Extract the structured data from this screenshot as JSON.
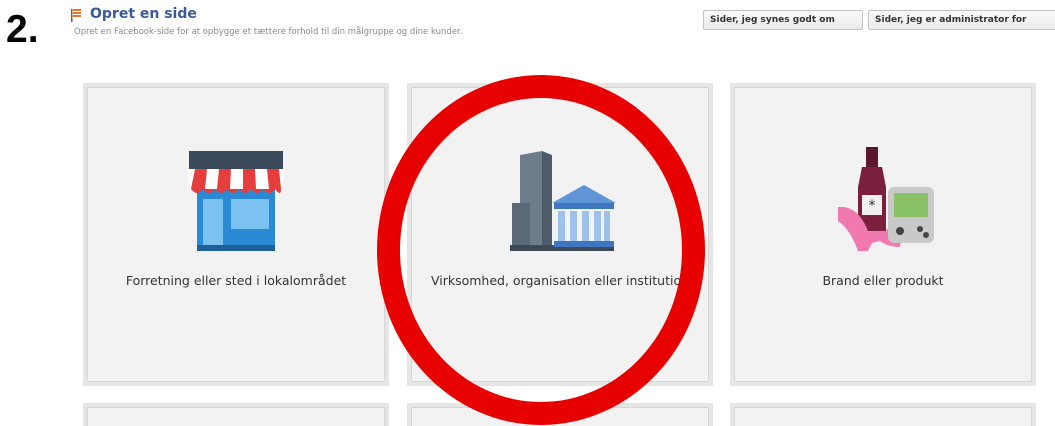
{
  "step": {
    "number": "2."
  },
  "header": {
    "icon": "flag-icon",
    "title": "Opret en side",
    "subtitle": "Opret en Facebook-side for at opbygge et tættere forhold til din målgruppe og dine kunder."
  },
  "top_buttons": {
    "liked_label": "Sider, jeg synes godt om",
    "admin_label": "Sider, jeg er administrator for"
  },
  "categories": [
    {
      "label": "Forretning eller sted i lokalområdet",
      "icon": "storefront-icon"
    },
    {
      "label": "Virksomhed, organisation eller institution",
      "icon": "building-institution-icon"
    },
    {
      "label": "Brand eller produkt",
      "icon": "products-icon"
    }
  ],
  "annotation": {
    "color": "#e60000",
    "shape": "circle",
    "target": "Virksomhed, organisation eller institution"
  },
  "colors": {
    "link_blue": "#3b5998",
    "tile_bg": "#f2f2f2",
    "tile_border": "#e6e6e6"
  }
}
